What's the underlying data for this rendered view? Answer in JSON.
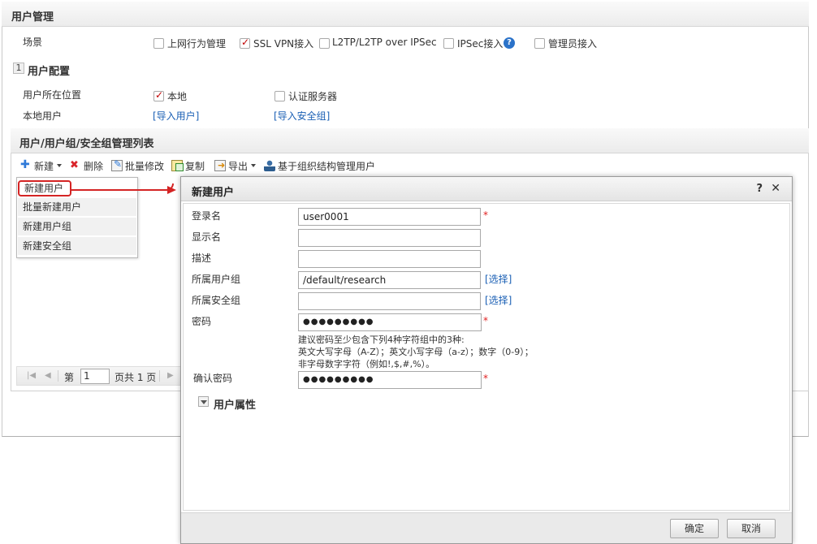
{
  "page": {
    "title": "用户管理"
  },
  "scene": {
    "label": "场景",
    "options": [
      {
        "label": "上网行为管理",
        "checked": false
      },
      {
        "label": "SSL VPN接入",
        "checked": true
      },
      {
        "label": "L2TP/L2TP over IPSec",
        "checked": false
      },
      {
        "label": "IPSec接入",
        "checked": false
      },
      {
        "label": "管理员接入",
        "checked": false
      }
    ],
    "help_glyph": "?"
  },
  "user_config": {
    "section_num": "1",
    "title": "用户配置",
    "location_label": "用户所在位置",
    "location_options": [
      {
        "label": "本地",
        "checked": true
      },
      {
        "label": "认证服务器",
        "checked": false
      }
    ],
    "local_user_label": "本地用户",
    "import_users_link": "[导入用户]",
    "import_secgroup_link": "[导入安全组]"
  },
  "list_panel": {
    "title": "用户/用户组/安全组管理列表",
    "toolbar": {
      "new": "新建",
      "delete": "删除",
      "batch_edit": "批量修改",
      "copy": "复制",
      "export": "导出",
      "org_manage": "基于组织结构管理用户"
    },
    "new_menu": [
      "新建用户",
      "批量新建用户",
      "新建用户组",
      "新建安全组"
    ],
    "pager": {
      "page_prefix": "第",
      "page_value": "1",
      "page_total": "页共 1 页"
    }
  },
  "dialog": {
    "title": "新建用户",
    "help": "?",
    "close": "✕",
    "fields": {
      "login_label": "登录名",
      "login_value": "user0001",
      "display_label": "显示名",
      "display_value": "",
      "desc_label": "描述",
      "desc_value": "",
      "group_label": "所属用户组",
      "group_value": "/default/research",
      "group_select": "[选择]",
      "secgroup_label": "所属安全组",
      "secgroup_value": "",
      "secgroup_select": "[选择]",
      "password_label": "密码",
      "password_value": "●●●●●●●●●",
      "password_hint_1": "建议密码至少包含下列4种字符组中的3种:",
      "password_hint_2": "英文大写字母（A-Z）；英文小写字母（a-z）；数字（0-9）；",
      "password_hint_3": "非字母数字字符（例如!,$,#,%）。",
      "confirm_label": "确认密码",
      "confirm_value": "●●●●●●●●●",
      "required_mark": "*"
    },
    "user_attr_title": "用户属性",
    "ok_button": "确定",
    "cancel_button": "取消"
  },
  "colors": {
    "link": "#1a5fb4",
    "highlight": "#d42424",
    "check": "#c00000"
  }
}
